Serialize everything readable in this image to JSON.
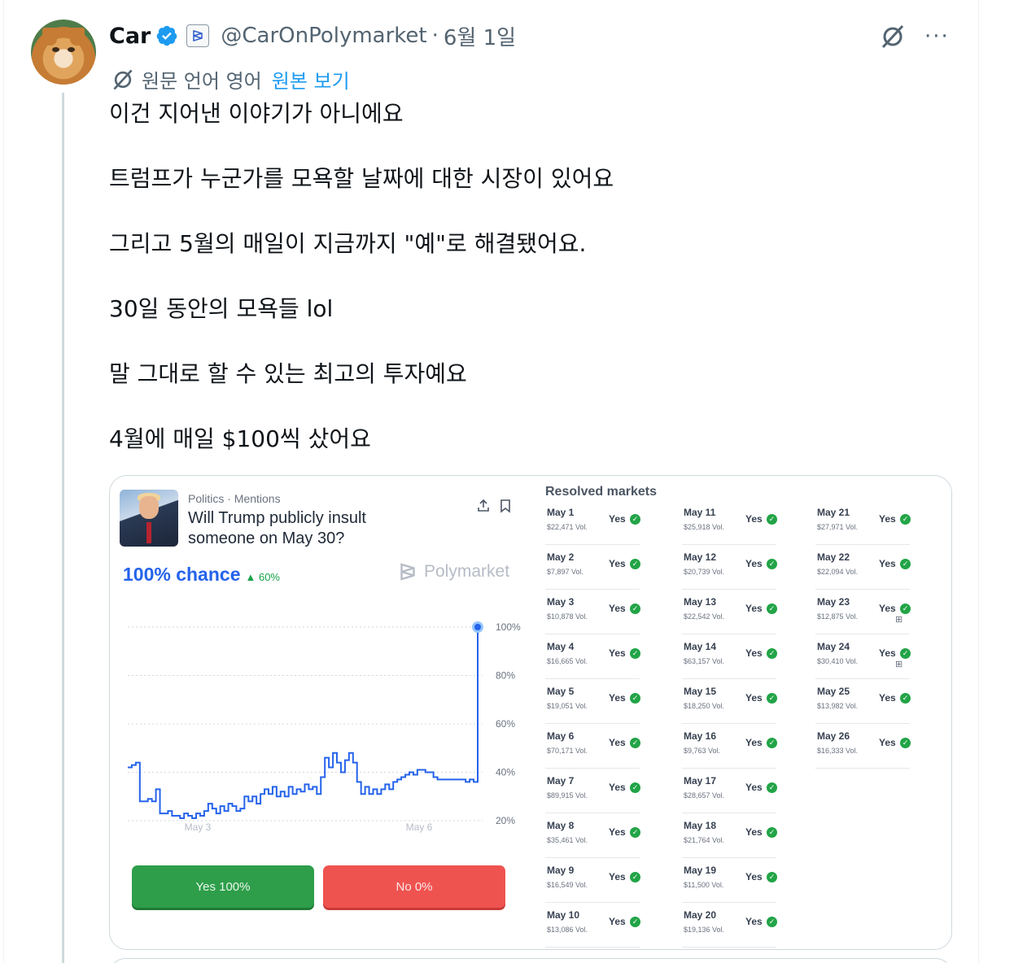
{
  "tweet": {
    "author_name": "Car",
    "handle": "@CarOnPolymarket",
    "separator": "·",
    "date": "6월 1일",
    "more": "···",
    "translation": {
      "label": "원문 언어 영어",
      "link": "원본 보기"
    },
    "lines": [
      "이건 지어낸 이야기가 아니에요",
      "트럼프가 누군가를 모욕할 날짜에 대한 시장이 있어요",
      "그리고 5월의 매일이 지금까지 \"예\"로 해결됐어요.",
      "30일 동안의 모욕들 lol",
      "말 그대로 할 수 있는 최고의 투자예요",
      "4월에 매일 $100씩 샀어요"
    ]
  },
  "colors": {
    "verified_blue": "#1d9bf0",
    "link_blue": "#1d9bf0",
    "chart_blue": "#2563eb",
    "yes_green": "#2e9e4a",
    "no_red": "#ef5350"
  },
  "market": {
    "category": "Politics · Mentions",
    "title": "Will Trump publicly insult someone on May 30?",
    "chance": "100% chance",
    "delta": "▲ 60%",
    "brand": "Polymarket",
    "yes_button": "Yes 100%",
    "no_button": "No 0%",
    "resolved_title": "Resolved markets",
    "resolved": [
      {
        "date": "May 1",
        "vol": "$22,471 Vol.",
        "result": "Yes"
      },
      {
        "date": "May 2",
        "vol": "$7,897 Vol.",
        "result": "Yes"
      },
      {
        "date": "May 3",
        "vol": "$10,878 Vol.",
        "result": "Yes"
      },
      {
        "date": "May 4",
        "vol": "$16,665 Vol.",
        "result": "Yes"
      },
      {
        "date": "May 5",
        "vol": "$19,051 Vol.",
        "result": "Yes"
      },
      {
        "date": "May 6",
        "vol": "$70,171 Vol.",
        "result": "Yes"
      },
      {
        "date": "May 7",
        "vol": "$89,915 Vol.",
        "result": "Yes"
      },
      {
        "date": "May 8",
        "vol": "$35,461 Vol.",
        "result": "Yes"
      },
      {
        "date": "May 9",
        "vol": "$16,549 Vol.",
        "result": "Yes"
      },
      {
        "date": "May 10",
        "vol": "$13,086 Vol.",
        "result": "Yes"
      },
      {
        "date": "May 11",
        "vol": "$25,918 Vol.",
        "result": "Yes"
      },
      {
        "date": "May 12",
        "vol": "$20,739 Vol.",
        "result": "Yes"
      },
      {
        "date": "May 13",
        "vol": "$22,542 Vol.",
        "result": "Yes"
      },
      {
        "date": "May 14",
        "vol": "$63,157 Vol.",
        "result": "Yes"
      },
      {
        "date": "May 15",
        "vol": "$18,250 Vol.",
        "result": "Yes"
      },
      {
        "date": "May 16",
        "vol": "$9,763 Vol.",
        "result": "Yes"
      },
      {
        "date": "May 17",
        "vol": "$28,657 Vol.",
        "result": "Yes"
      },
      {
        "date": "May 18",
        "vol": "$21,764 Vol.",
        "result": "Yes"
      },
      {
        "date": "May 19",
        "vol": "$11,500 Vol.",
        "result": "Yes"
      },
      {
        "date": "May 20",
        "vol": "$19,136 Vol.",
        "result": "Yes"
      },
      {
        "date": "May 21",
        "vol": "$27,971 Vol.",
        "result": "Yes"
      },
      {
        "date": "May 22",
        "vol": "$22,094 Vol.",
        "result": "Yes"
      },
      {
        "date": "May 23",
        "vol": "$12,875 Vol.",
        "result": "Yes",
        "gift": true
      },
      {
        "date": "May 24",
        "vol": "$30,410 Vol.",
        "result": "Yes",
        "gift": true
      },
      {
        "date": "May 25",
        "vol": "$13,982 Vol.",
        "result": "Yes"
      },
      {
        "date": "May 26",
        "vol": "$16,333 Vol.",
        "result": "Yes"
      }
    ]
  },
  "chart_data": {
    "type": "line",
    "title": "",
    "xlabel": "",
    "ylabel": "",
    "x_tick_labels": [
      "May 3",
      "May 6"
    ],
    "y_tick_labels": [
      "100%",
      "80%",
      "60%",
      "40%",
      "20%"
    ],
    "ylim": [
      20,
      100
    ],
    "grid": true,
    "series": [
      {
        "values": [
          42,
          43,
          44,
          28,
          28,
          29,
          28,
          33,
          23,
          23,
          24,
          22,
          22,
          21,
          23,
          22,
          21,
          23,
          22,
          24,
          27,
          25,
          23,
          26,
          24,
          27,
          26,
          24,
          25,
          30,
          28,
          30,
          27,
          31,
          33,
          31,
          34,
          30,
          32,
          30,
          34,
          31,
          33,
          32,
          35,
          33,
          34,
          31,
          38,
          46,
          42,
          48,
          44,
          40,
          45,
          48,
          44,
          36,
          31,
          34,
          31,
          33,
          31,
          33,
          35,
          33,
          36,
          37,
          38,
          39,
          40,
          39,
          41,
          41,
          40,
          40,
          38,
          37,
          37,
          37,
          37,
          37,
          37,
          37,
          36,
          37,
          36,
          100
        ]
      }
    ]
  }
}
